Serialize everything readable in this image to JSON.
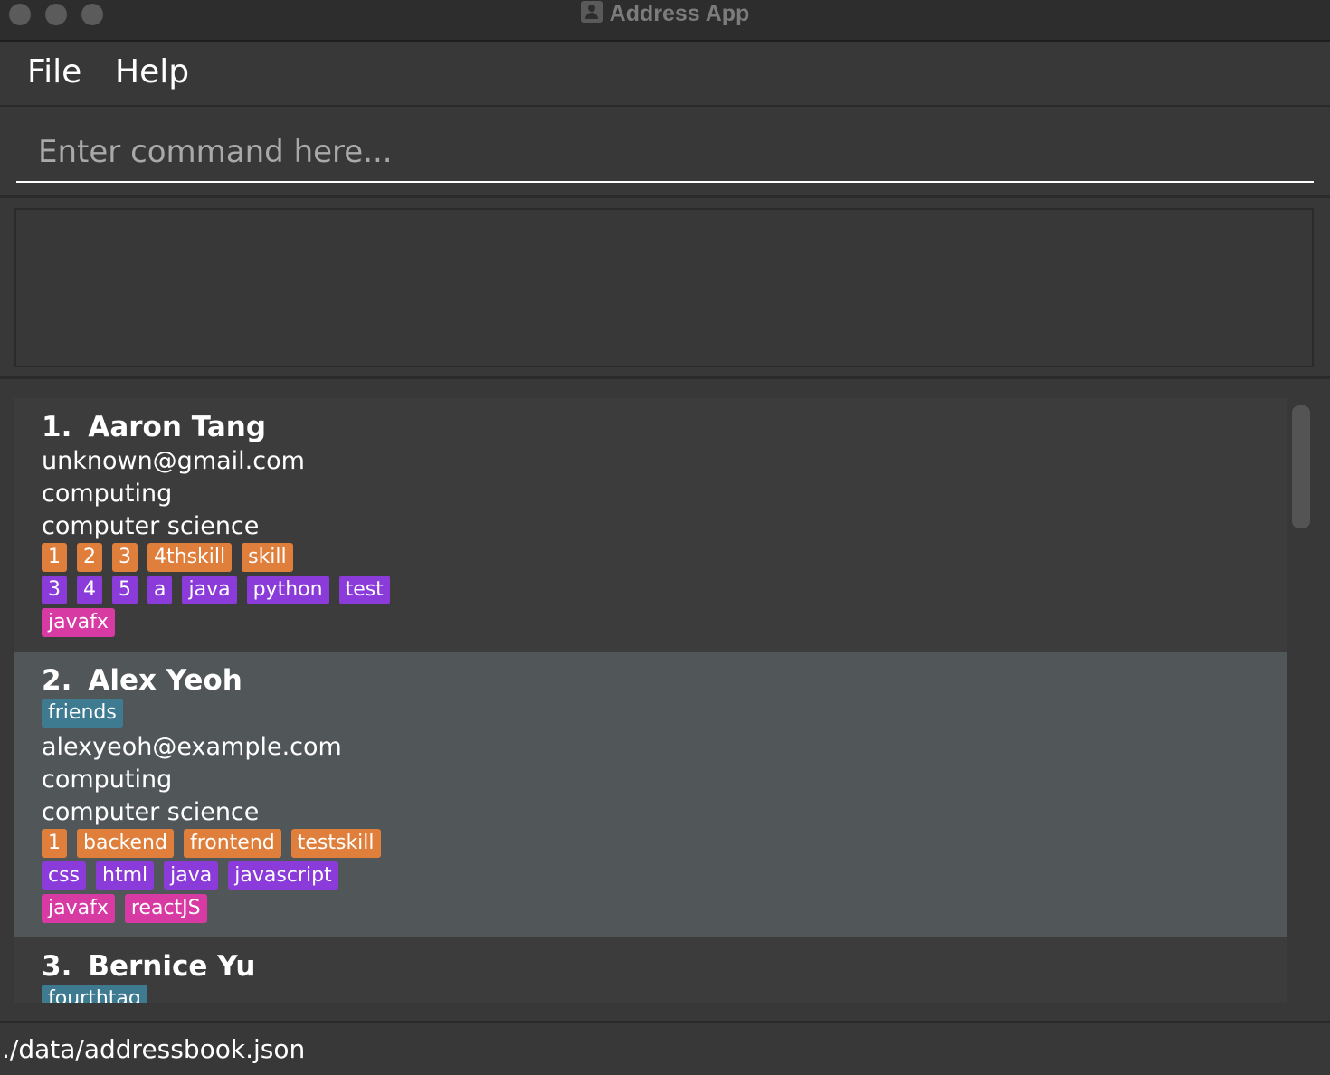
{
  "window": {
    "title": "Address App"
  },
  "menu": {
    "file": "File",
    "help": "Help"
  },
  "command": {
    "placeholder": "Enter command here...",
    "value": ""
  },
  "result": {
    "text": ""
  },
  "persons": [
    {
      "index": "1.",
      "name": "Aaron Tang",
      "tags": [],
      "email": "unknown@gmail.com",
      "faculty": "computing",
      "major": "computer science",
      "skills": [
        "1",
        "2",
        "3",
        "4thskill",
        "skill"
      ],
      "languages": [
        "3",
        "4",
        "5",
        "a",
        "java",
        "python",
        "test"
      ],
      "frameworks": [
        "javafx"
      ]
    },
    {
      "index": "2.",
      "name": "Alex Yeoh",
      "tags": [
        "friends"
      ],
      "email": "alexyeoh@example.com",
      "faculty": "computing",
      "major": "computer science",
      "skills": [
        "1",
        "backend",
        "frontend",
        "testskill"
      ],
      "languages": [
        "css",
        "html",
        "java",
        "javascript"
      ],
      "frameworks": [
        "javafx",
        "reactJS"
      ]
    },
    {
      "index": "3.",
      "name": "Bernice Yu",
      "tags": [
        "fourthtag"
      ]
    }
  ],
  "status": {
    "file_path": "./data/addressbook.json"
  },
  "colors": {
    "skill_tag": "#e07f3c",
    "language_tag": "#8b3bd9",
    "framework_tag": "#d83aa3",
    "plain_tag": "#3e7b91",
    "background": "#383838",
    "selected_card": "#515658"
  }
}
